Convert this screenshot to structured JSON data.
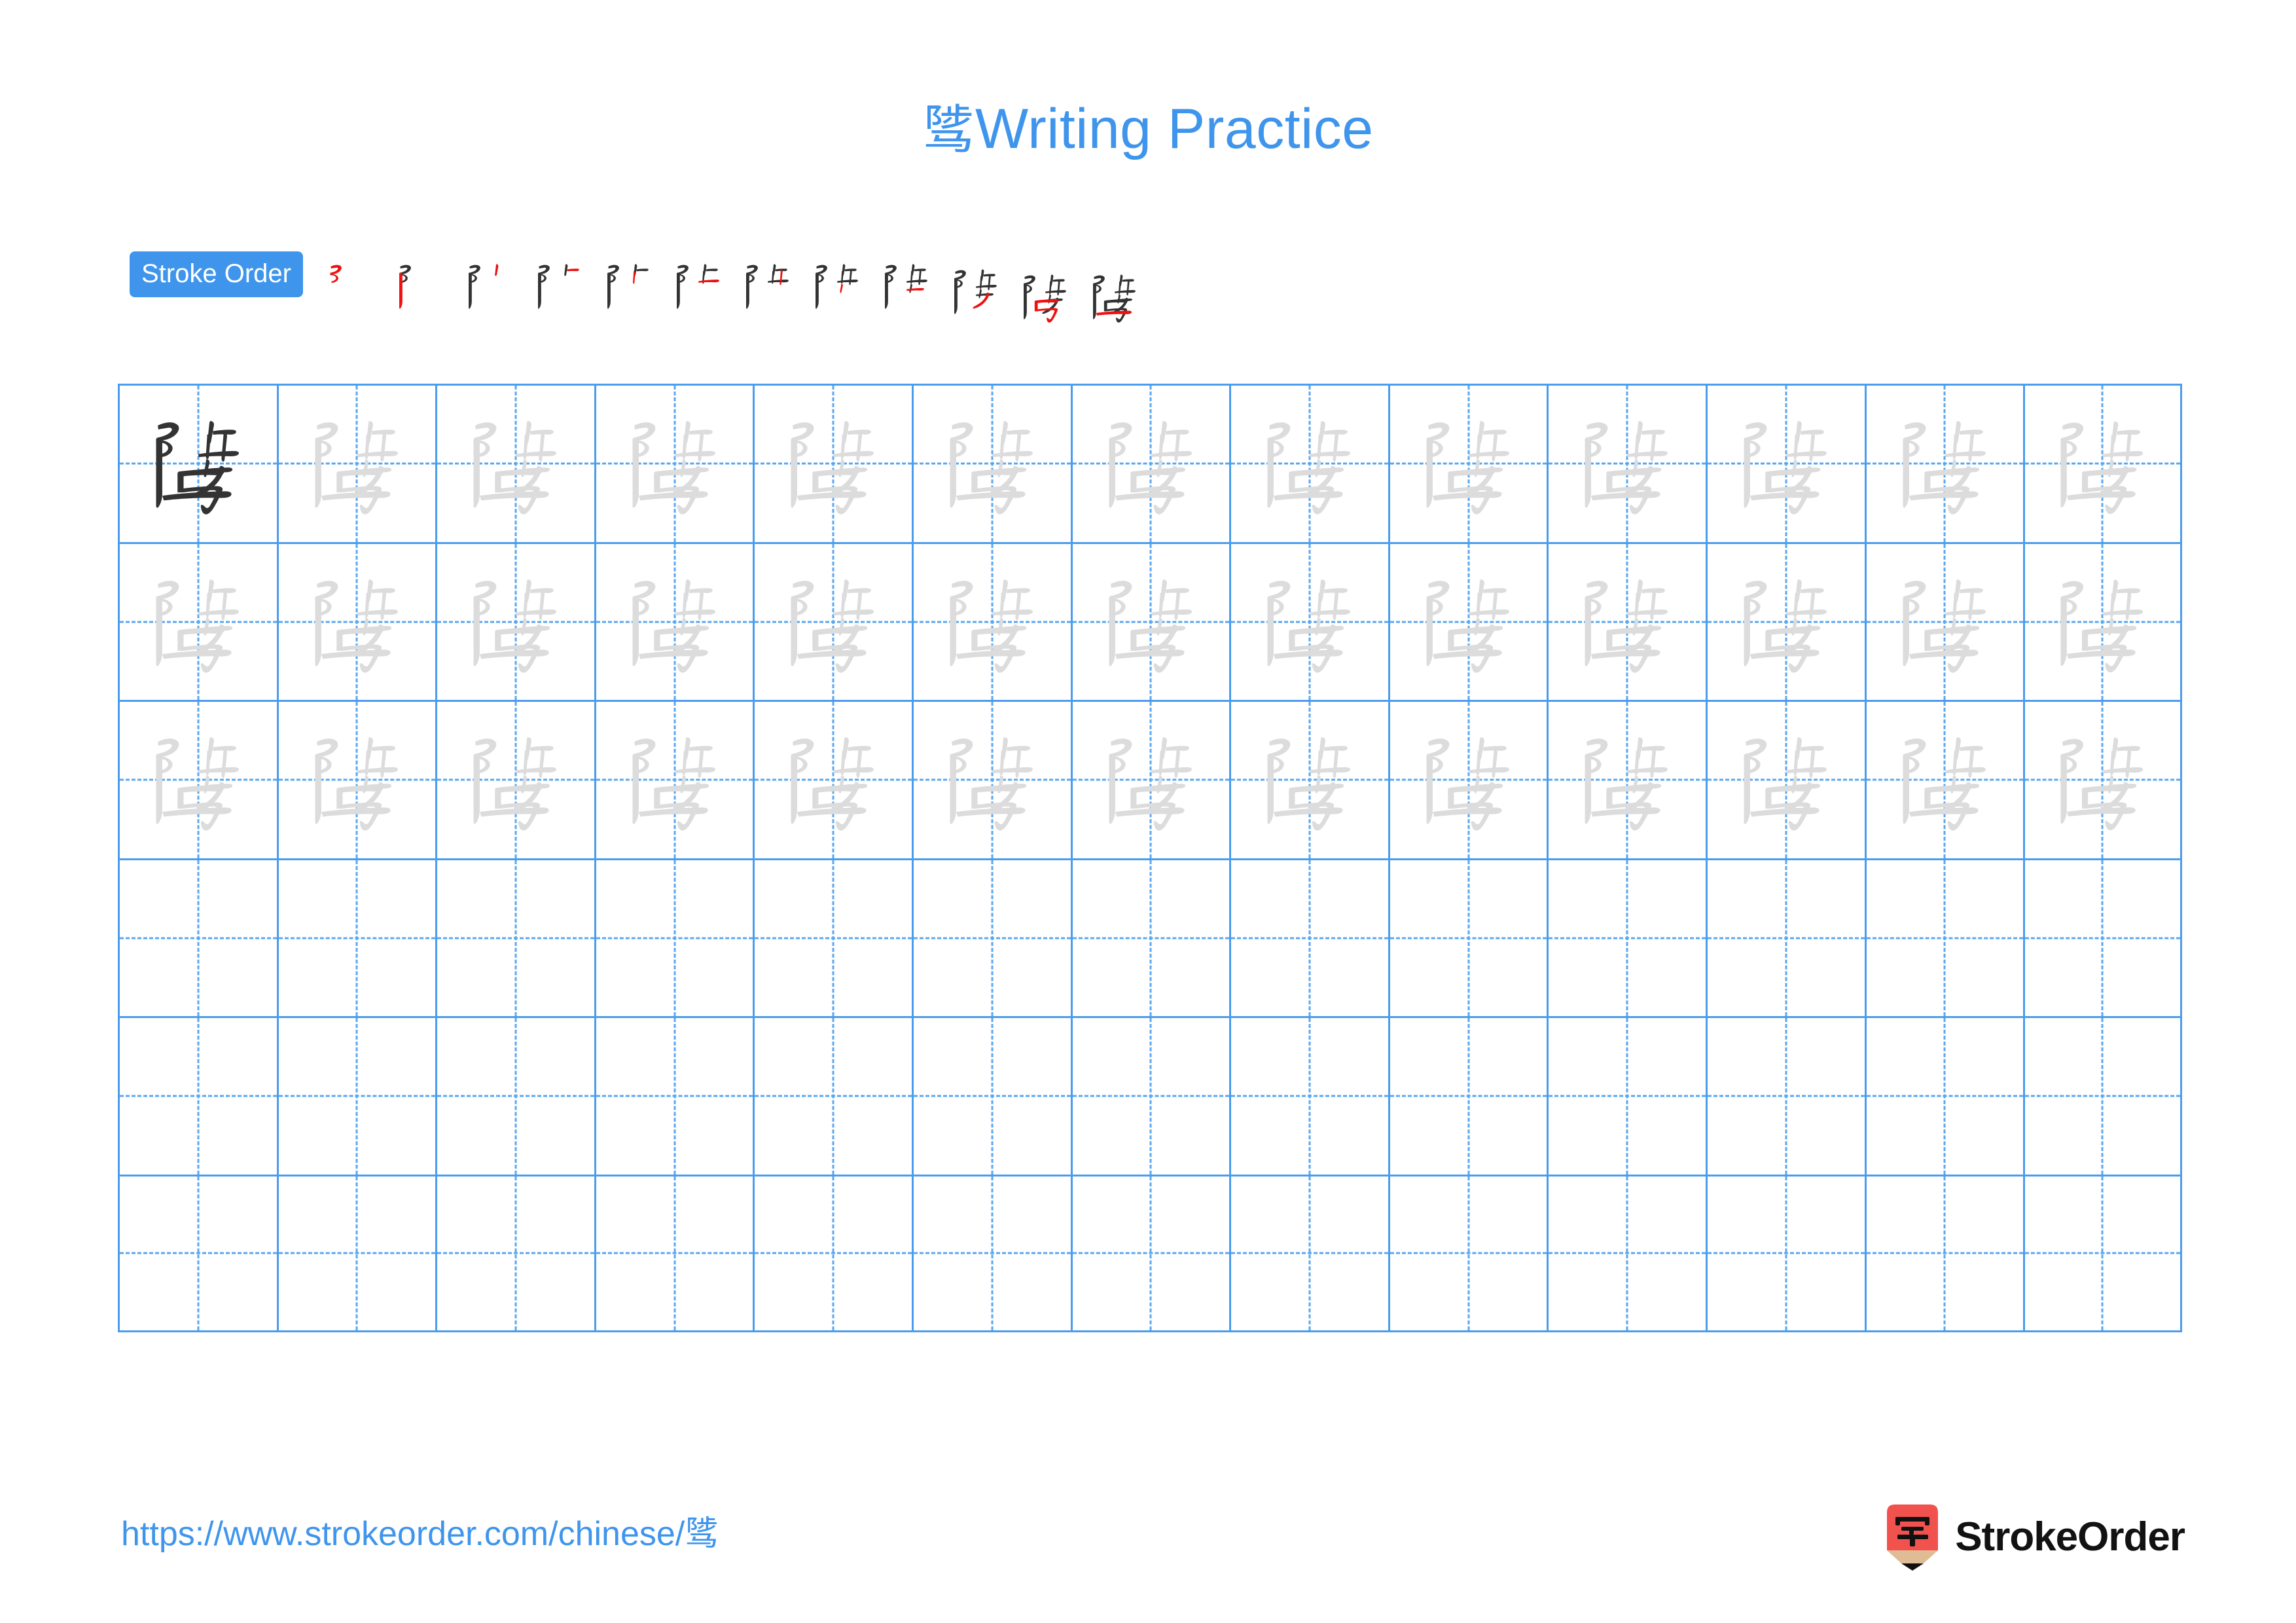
{
  "page": {
    "character": "骘",
    "title_suffix": " Writing Practice",
    "background_color": "#ffffff",
    "accent_color": "#3f95ec",
    "grid_line_color": "#4a9ced",
    "guide_line_color": "#5aa7f0",
    "model_char_color": "#333333",
    "trace_char_color": "#dcdcdc",
    "new_stroke_color": "#ee1111"
  },
  "header": {
    "title_char": "骘",
    "title_label": "Writing Practice"
  },
  "stroke_order": {
    "badge_label": "Stroke Order",
    "total_strokes": 12,
    "steps": [
      {
        "index": 1,
        "strokes_shown": 1,
        "new_stroke": 1
      },
      {
        "index": 2,
        "strokes_shown": 2,
        "new_stroke": 2
      },
      {
        "index": 3,
        "strokes_shown": 3,
        "new_stroke": 3
      },
      {
        "index": 4,
        "strokes_shown": 4,
        "new_stroke": 4
      },
      {
        "index": 5,
        "strokes_shown": 5,
        "new_stroke": 5
      },
      {
        "index": 6,
        "strokes_shown": 6,
        "new_stroke": 6
      },
      {
        "index": 7,
        "strokes_shown": 7,
        "new_stroke": 7
      },
      {
        "index": 8,
        "strokes_shown": 8,
        "new_stroke": 8
      },
      {
        "index": 9,
        "strokes_shown": 9,
        "new_stroke": 9
      },
      {
        "index": 10,
        "strokes_shown": 10,
        "new_stroke": 10
      },
      {
        "index": 11,
        "strokes_shown": 11,
        "new_stroke": 11
      },
      {
        "index": 12,
        "strokes_shown": 12,
        "new_stroke": 12
      }
    ]
  },
  "practice_grid": {
    "columns": 13,
    "rows": 6,
    "rows_with_characters": 3,
    "empty_rows": 3,
    "model_cell": {
      "row": 1,
      "column": 1
    },
    "cell_guides": "dashed-cross"
  },
  "footer": {
    "url_prefix": "https://www.strokeorder.com/chinese/",
    "url_char": "骘",
    "brand_name": "StrokeOrder",
    "brand_logo_char": "字",
    "brand_logo_color": "#f2524e",
    "brand_logo_wood_color": "#e0bc96"
  }
}
